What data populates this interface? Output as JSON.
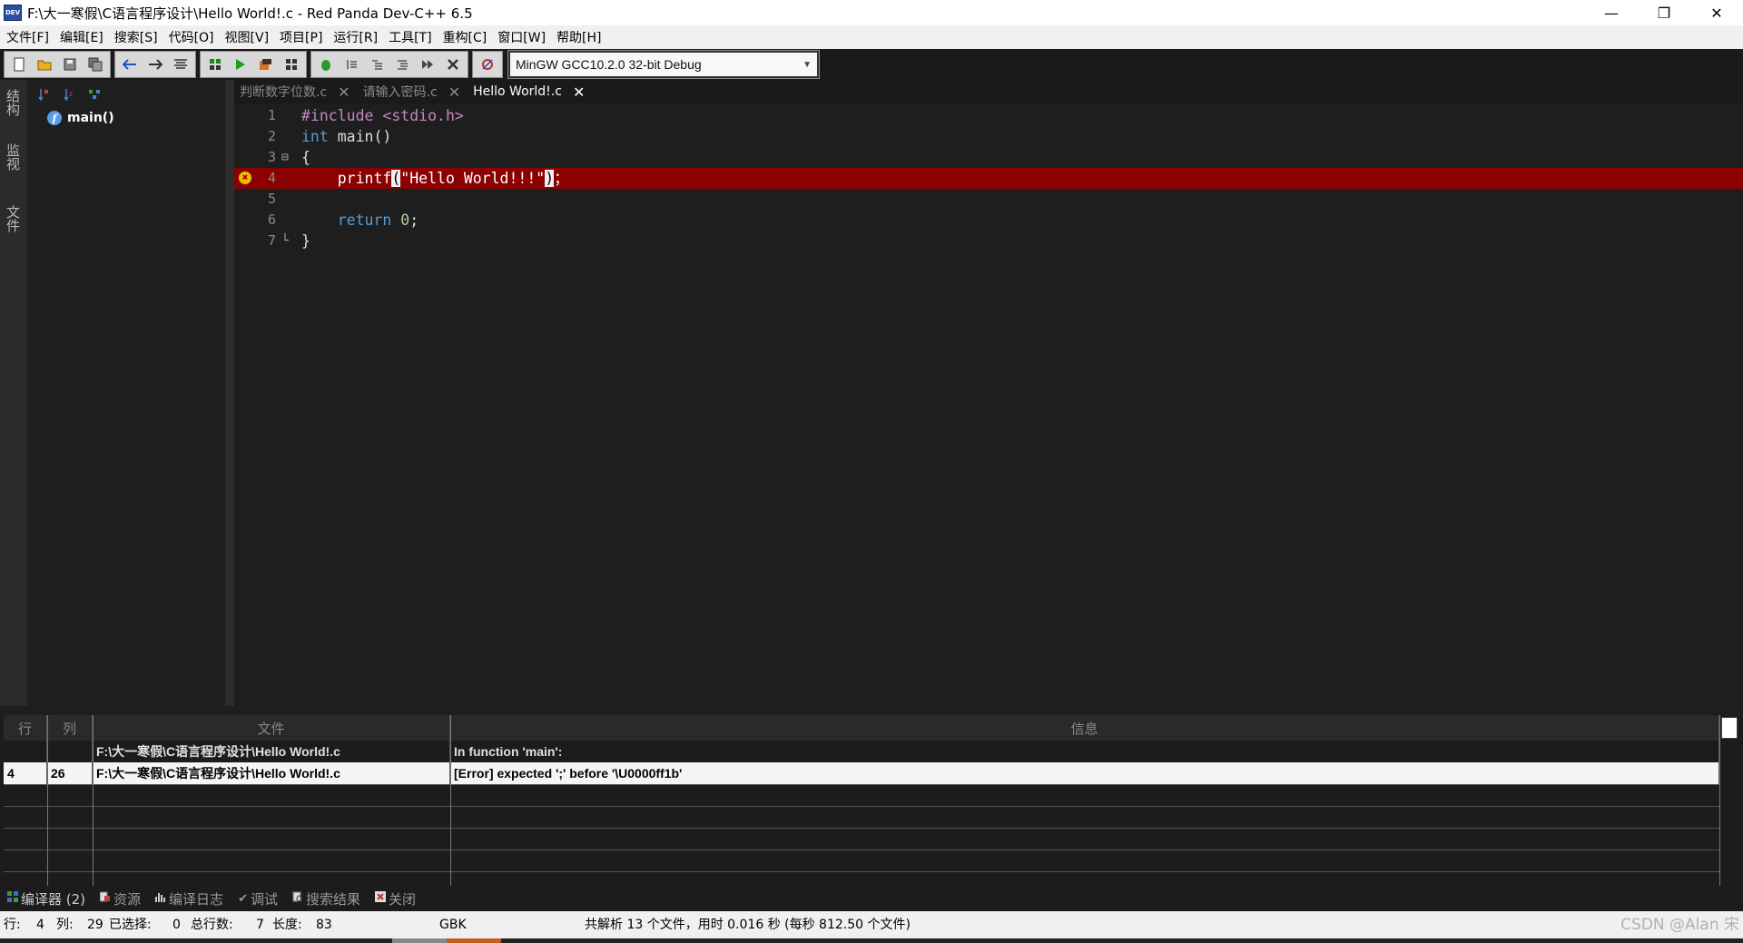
{
  "window": {
    "title": "F:\\大一寒假\\C语言程序设计\\Hello World!.c - Red Panda Dev-C++ 6.5",
    "icon_text": "DEV",
    "controls": [
      "—",
      "❐",
      "✕"
    ]
  },
  "menu": [
    "文件[F]",
    "编辑[E]",
    "搜索[S]",
    "代码[O]",
    "视图[V]",
    "项目[P]",
    "运行[R]",
    "工具[T]",
    "重构[C]",
    "窗口[W]",
    "帮助[H]"
  ],
  "toolbar": {
    "compiler": "MinGW GCC10.2.0 32-bit Debug"
  },
  "side_tabs": [
    "结构",
    "监视",
    "文件"
  ],
  "structure": {
    "items": [
      {
        "icon": "f",
        "label": "main()"
      }
    ]
  },
  "tabs": [
    {
      "label": "判断数字位数.c",
      "active": false
    },
    {
      "label": "请输入密码.c",
      "active": false
    },
    {
      "label": "Hello World!.c",
      "active": true
    }
  ],
  "editor": {
    "lines": [
      {
        "no": "1",
        "text": "#include <stdio.h>"
      },
      {
        "no": "2",
        "text": "int main()"
      },
      {
        "no": "3",
        "text": "{"
      },
      {
        "no": "4",
        "text": "    printf(\"Hello World!!!\");",
        "error": true
      },
      {
        "no": "5",
        "text": ""
      },
      {
        "no": "6",
        "text": "    return 0;"
      },
      {
        "no": "7",
        "text": "}"
      }
    ]
  },
  "messages": {
    "headers": [
      "行",
      "列",
      "文件",
      "信息"
    ],
    "rows": [
      {
        "line": "",
        "col": "",
        "file": "F:\\大一寒假\\C语言程序设计\\Hello World!.c",
        "info": "In function 'main':",
        "selected": false
      },
      {
        "line": "4",
        "col": "26",
        "file": "F:\\大一寒假\\C语言程序设计\\Hello World!.c",
        "info": "[Error] expected ';' before '\\U0000ff1b'",
        "selected": true
      }
    ]
  },
  "bottom_tabs": [
    {
      "label": "编译器 (2)",
      "icon": "grid-icon"
    },
    {
      "label": "资源",
      "icon": "resource-icon"
    },
    {
      "label": "编译日志",
      "icon": "chart-icon"
    },
    {
      "label": "调试",
      "icon": "check-icon"
    },
    {
      "label": "搜索结果",
      "icon": "search-results-icon"
    },
    {
      "label": "关闭",
      "icon": "close-icon"
    }
  ],
  "status": {
    "line_label": "行:",
    "line": "4",
    "col_label": "列:",
    "col": "29",
    "selected_label": "已选择:",
    "selected": "0",
    "total_label": "总行数:",
    "total": "7",
    "length_label": "长度:",
    "length": "83",
    "encoding": "GBK",
    "parse_info": "共解析 13 个文件，用时 0.016 秒 (每秒 812.50 个文件)"
  },
  "watermark": "CSDN @Alan 宋",
  "colors": {
    "error_line": "#8b0000",
    "editor_bg": "#1e1e1e",
    "keyword": "#569cd6",
    "preprocessor": "#c586c0",
    "string": "#ce9178"
  }
}
